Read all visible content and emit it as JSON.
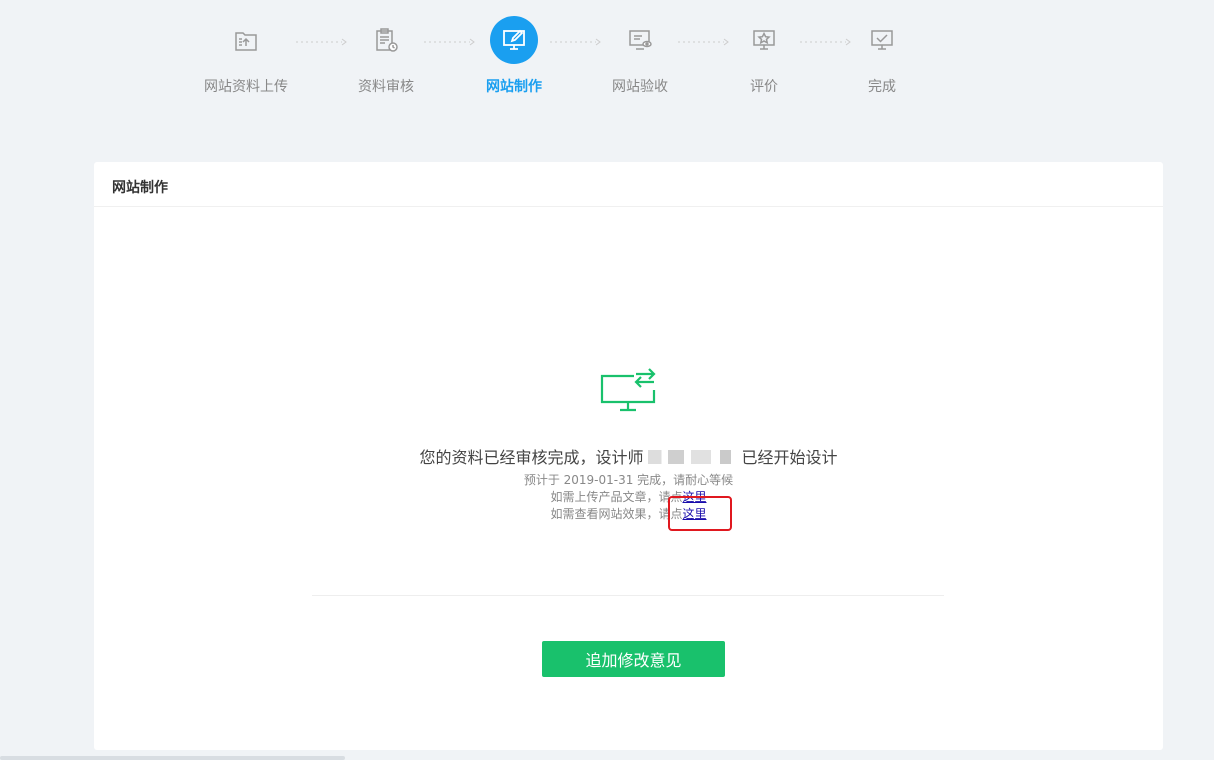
{
  "steps": [
    {
      "label": "网站资料上传",
      "icon": "folder-upload-icon",
      "active": false
    },
    {
      "label": "资料审核",
      "icon": "clipboard-clock-icon",
      "active": false
    },
    {
      "label": "网站制作",
      "icon": "edit-monitor-icon",
      "active": true
    },
    {
      "label": "网站验收",
      "icon": "monitor-eye-icon",
      "active": false
    },
    {
      "label": "评价",
      "icon": "star-monitor-icon",
      "active": false
    },
    {
      "label": "完成",
      "icon": "check-monitor-icon",
      "active": false
    }
  ],
  "card": {
    "title": "网站制作",
    "main_text_prefix": "您的资料已经审核完成，设计师",
    "main_text_suffix": "已经开始设计",
    "eta_line": "预计于 2019-01-31 完成，请耐心等候",
    "upload_line_prefix": "如需上传产品文章，请点",
    "upload_link": "这里",
    "preview_line_prefix": "如需查看网站效果，请点",
    "preview_link": "这里",
    "button_label": "追加修改意见"
  },
  "colors": {
    "accent_blue": "#1a9ff0",
    "accent_green": "#19c16c",
    "highlight_red": "#e0181f"
  }
}
